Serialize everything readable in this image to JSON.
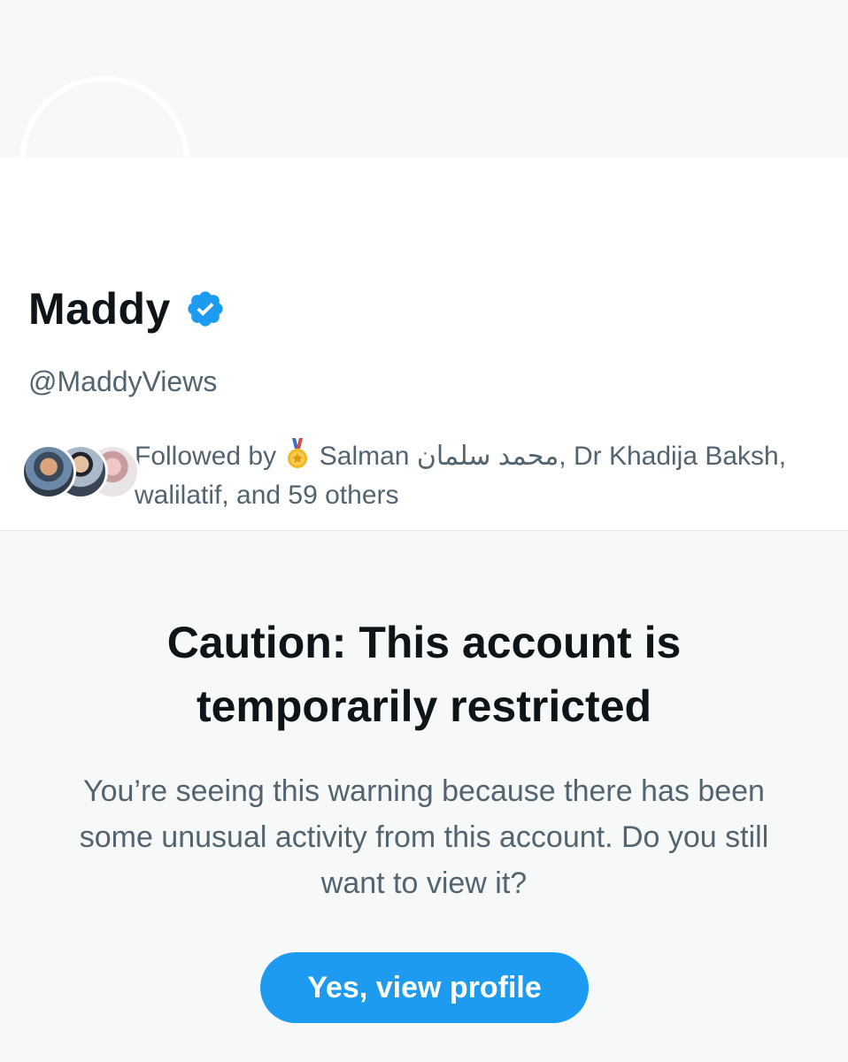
{
  "profile": {
    "display_name": "Maddy",
    "handle": "@MaddyViews",
    "verified": true,
    "verified_color": "#1d9bf0",
    "followed_by": {
      "prefix": "Followed by",
      "medal_icon": "medal-icon",
      "text_after_medal": "Salman محمد سلمان, Dr Khadija Baksh, walilatif, and 59 others"
    }
  },
  "warning": {
    "title": "Caution: This account is temporarily restricted",
    "body": "You’re seeing this warning because there has been some unusual activity from this account. Do you still want to view it?",
    "button_label": "Yes, view profile"
  },
  "colors": {
    "accent": "#1d9bf0",
    "background": "#f7f9f9",
    "secondary_text": "#536471",
    "primary_text": "#0f1419"
  }
}
